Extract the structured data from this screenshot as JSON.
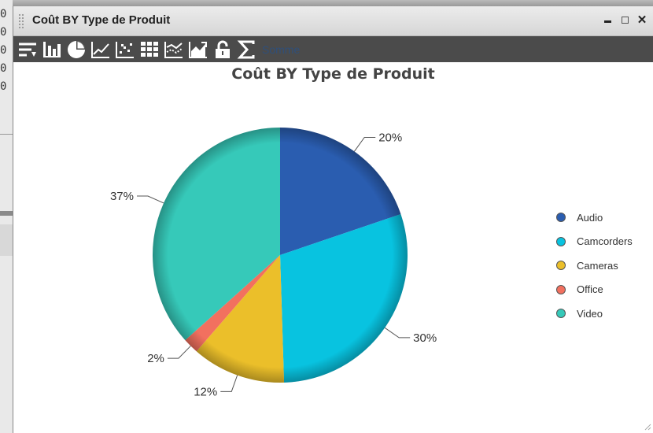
{
  "window": {
    "title": "Coût BY Type de Produit"
  },
  "toolbar": {
    "icons": [
      "sort-icon",
      "bar-chart-icon",
      "pie-chart-icon",
      "line-chart-icon",
      "scatter-chart-icon",
      "table-icon",
      "combo-chart-icon",
      "area-chart-icon",
      "lock-icon",
      "sigma-icon"
    ],
    "aggregation_label": "Somme"
  },
  "chart_data": {
    "type": "pie",
    "title": "Coût BY Type de Produit",
    "categories": [
      "Audio",
      "Camcorders",
      "Cameras",
      "Office",
      "Video"
    ],
    "values": [
      20,
      30,
      12,
      2,
      37
    ],
    "labels": [
      "20%",
      "30%",
      "12%",
      "2%",
      "37%"
    ],
    "colors": [
      "#2a5db0",
      "#08c3e0",
      "#ebbf2a",
      "#f2705f",
      "#36c9b9"
    ],
    "legend_position": "right"
  }
}
